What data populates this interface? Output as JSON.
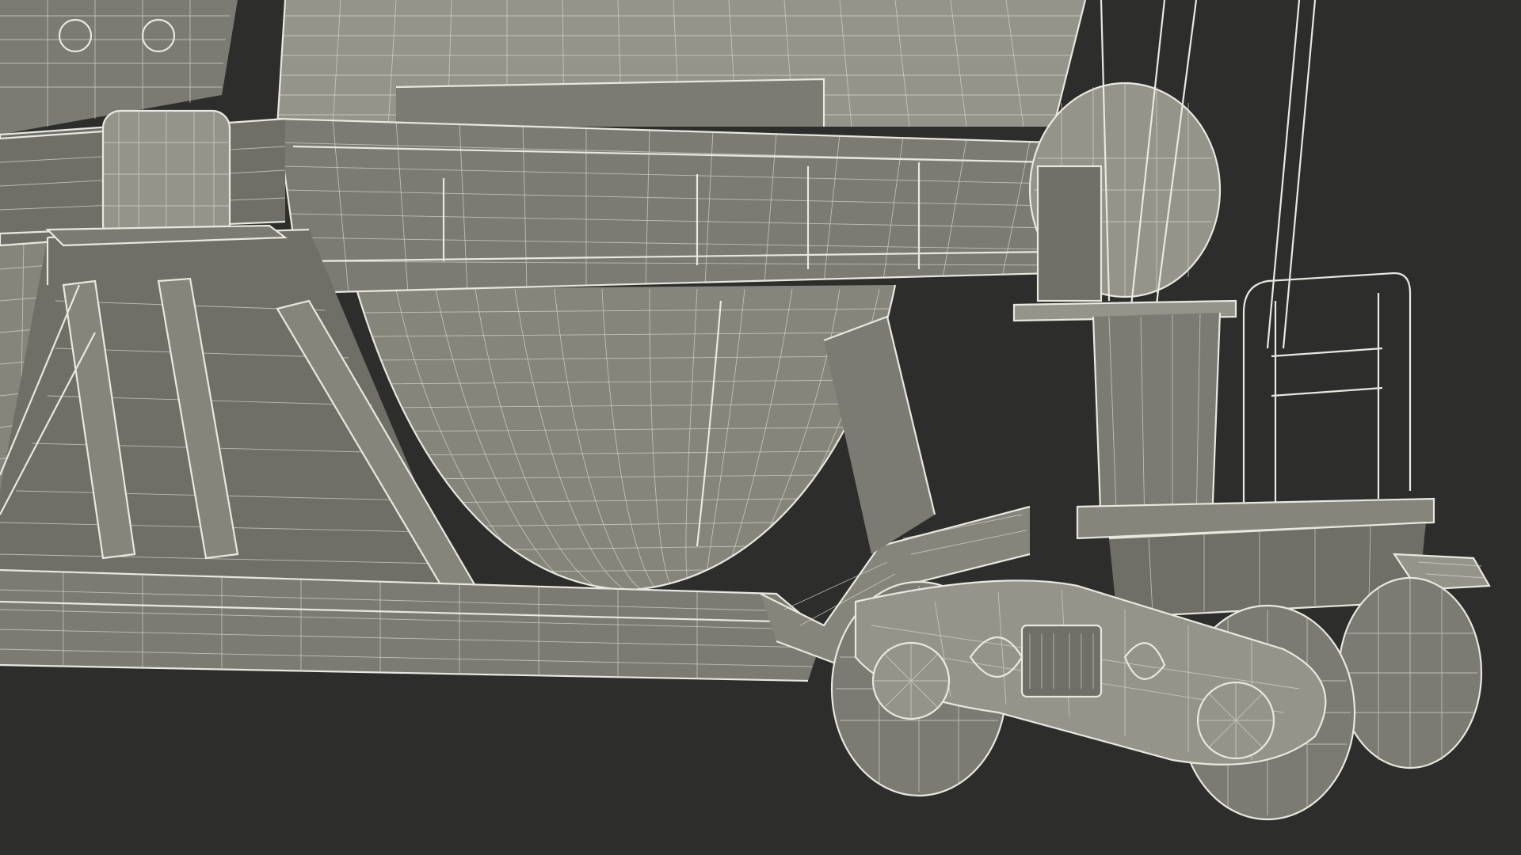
{
  "scene": {
    "subject": "wireframe-render-hopper-rail-car",
    "background_color": "#2d2d2c",
    "body_color": "#85857c",
    "wire_color": "#e8e8e0"
  }
}
